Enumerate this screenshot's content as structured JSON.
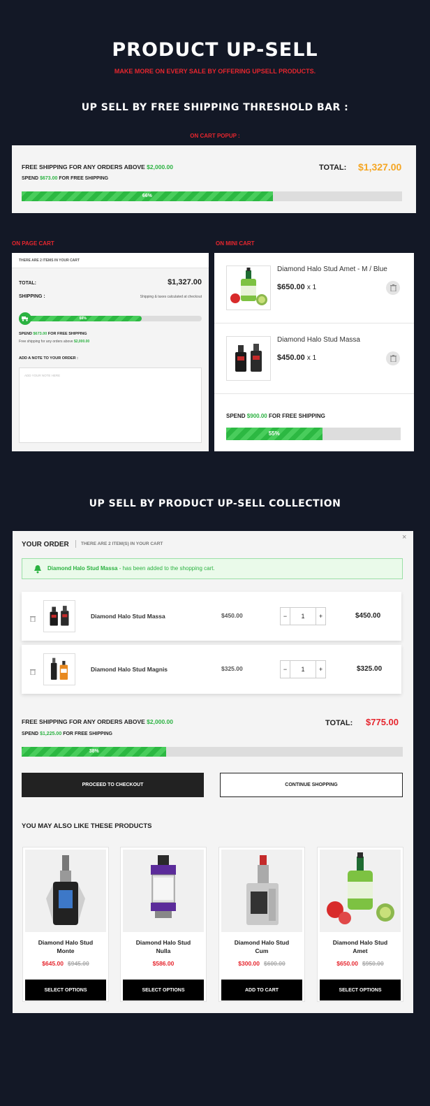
{
  "hero": {
    "title": "PRODUCT UP-SELL",
    "subtitle": "MAKE MORE ON EVERY SALE BY OFFERING UPSELL PRODUCTS."
  },
  "section1": {
    "title": "UP SELL BY FREE SHIPPING THRESHOLD BAR :",
    "cart_popup_label": "ON CART POPUP :"
  },
  "popup": {
    "free_text": "FREE SHIPPING FOR ANY ORDERS ABOVE",
    "threshold": "$2,000.00",
    "spend_prefix": "SPEND",
    "spend_amount": "$673.00",
    "spend_suffix": "FOR FREE SHIPPING",
    "total_label": "TOTAL:",
    "total_value": "$1,327.00",
    "progress_label": "66%",
    "progress": 0.66,
    "total_color": "#f5a623"
  },
  "page_cart": {
    "label": "ON PAGE CART",
    "items_text": "THERE ARE 2 ITEMS IN YOUR CART",
    "total_label": "TOTAL:",
    "total_value": "$1,327.00",
    "shipping_label": "SHIPPING :",
    "shipping_note": "Shipping & taxes calculated at checkout",
    "progress_label": "66%",
    "progress": 0.66,
    "spend_prefix": "SPEND",
    "spend_amount": "$673.00",
    "spend_suffix": "FOR FREE SHIPPING",
    "free_note": "Free shipping for any orders above",
    "free_amount": "$2,000.00",
    "note_label": "ADD A NOTE TO YOUR ORDER :",
    "note_placeholder": "ADD YOUR NOTE HERE"
  },
  "mini_cart": {
    "label": "ON MINI CART",
    "items": [
      {
        "name": "Diamond Halo Stud Amet - M / Blue",
        "price": "$650.00",
        "qty": "x 1",
        "image": "eliquid-bottle"
      },
      {
        "name": "Diamond Halo Stud Massa",
        "price": "$450.00",
        "qty": "x 1",
        "image": "vape-kit"
      }
    ],
    "spend_prefix": "SPEND",
    "spend_amount": "$900.00",
    "spend_suffix": "FOR FREE SHIPPING",
    "progress_label": "55%",
    "progress": 0.55
  },
  "section2": {
    "title": "UP SELL BY PRODUCT UP-SELL COLLECTION"
  },
  "order": {
    "title": "YOUR ORDER",
    "subtitle": "THERE ARE 2 ITEM(S) IN YOUR CART",
    "close": "×",
    "alert_product": "Diamond Halo Stud Massa",
    "alert_text": "- has been added to the shopping cart.",
    "items": [
      {
        "name": "Diamond Halo Stud Massa",
        "price": "$450.00",
        "qty": "1",
        "subtotal": "$450.00",
        "image": "vape-kit"
      },
      {
        "name": "Diamond Halo Stud Magnis",
        "price": "$325.00",
        "qty": "1",
        "subtotal": "$325.00",
        "image": "vape-pen"
      }
    ],
    "minus": "−",
    "plus": "+",
    "free_text": "FREE SHIPPING FOR ANY ORDERS ABOVE",
    "threshold": "$2,000.00",
    "spend_prefix": "SPEND",
    "spend_amount": "$1,225.00",
    "spend_suffix": "FOR FREE SHIPPING",
    "total_label": "TOTAL:",
    "total_value": "$775.00",
    "progress_label": "38%",
    "progress": 0.38,
    "checkout": "PROCEED TO CHECKOUT",
    "continue": "CONTINUE SHOPPING",
    "also_like": "YOU MAY ALSO LIKE THESE PRODUCTS",
    "products": [
      {
        "name1": "Diamond Halo Stud",
        "name2": "Monte",
        "price": "$645.00",
        "old": "$945.00",
        "button": "SELECT OPTIONS",
        "image": "vape-mod"
      },
      {
        "name1": "Diamond Halo Stud",
        "name2": "Nulla",
        "price": "$586.00",
        "old": "",
        "button": "SELECT OPTIONS",
        "image": "vape-tank"
      },
      {
        "name1": "Diamond Halo Stud",
        "name2": "Cum",
        "price": "$300.00",
        "old": "$600.00",
        "button": "ADD TO CART",
        "image": "vape-box"
      },
      {
        "name1": "Diamond Halo Stud",
        "name2": "Amet",
        "price": "$650.00",
        "old": "$950.00",
        "button": "SELECT OPTIONS",
        "image": "eliquid-bottle"
      }
    ],
    "total_color": "#e6262e"
  }
}
